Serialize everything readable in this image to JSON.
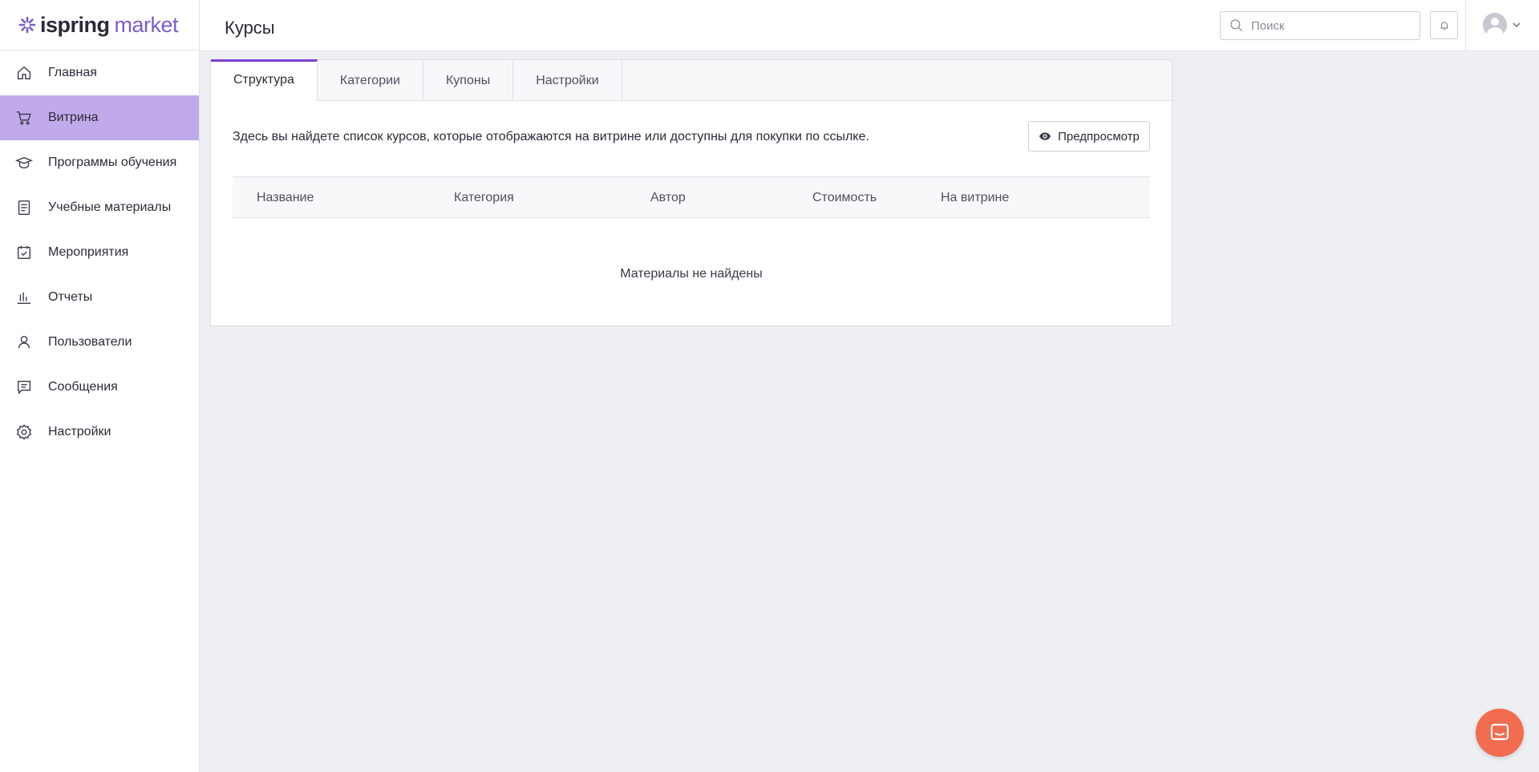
{
  "brand": {
    "name_part1": "ispring",
    "name_part2": "market",
    "accent_color": "#7b5ccc"
  },
  "sidebar": {
    "items": [
      {
        "label": "Главная",
        "icon": "home-icon",
        "active": false
      },
      {
        "label": "Витрина",
        "icon": "cart-icon",
        "active": true
      },
      {
        "label": "Программы обучения",
        "icon": "graduation-cap-icon",
        "active": false
      },
      {
        "label": "Учебные материалы",
        "icon": "document-icon",
        "active": false
      },
      {
        "label": "Мероприятия",
        "icon": "calendar-check-icon",
        "active": false
      },
      {
        "label": "Отчеты",
        "icon": "bar-chart-icon",
        "active": false
      },
      {
        "label": "Пользователи",
        "icon": "user-icon",
        "active": false
      },
      {
        "label": "Сообщения",
        "icon": "message-icon",
        "active": false
      },
      {
        "label": "Настройки",
        "icon": "gear-icon",
        "active": false
      }
    ],
    "active_color": "#c0aaec"
  },
  "header": {
    "title": "Курсы",
    "search": {
      "placeholder": "Поиск",
      "value": ""
    }
  },
  "tabs": [
    {
      "label": "Структура",
      "active": true
    },
    {
      "label": "Категории",
      "active": false
    },
    {
      "label": "Купоны",
      "active": false
    },
    {
      "label": "Настройки",
      "active": false
    }
  ],
  "content": {
    "intro": "Здесь вы найдете список курсов, которые отображаются на витрине или доступны для покупки по ссылке.",
    "preview_label": "Предпросмотр",
    "table": {
      "columns": [
        "Название",
        "Категория",
        "Автор",
        "Стоимость",
        "На витрине"
      ],
      "rows": [],
      "empty_text": "Материалы не найдены"
    }
  },
  "chat_widget": {
    "icon": "chat-icon",
    "color": "#f26c4f"
  }
}
